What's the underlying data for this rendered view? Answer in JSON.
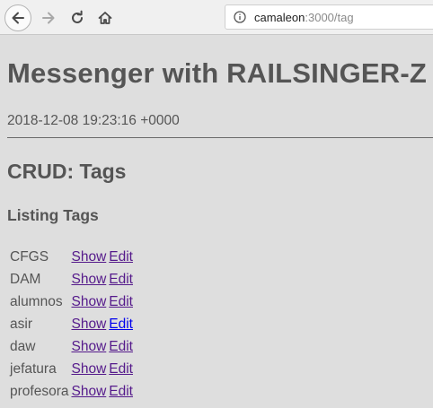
{
  "browser": {
    "url_host": "camaleon",
    "url_rest": ":3000/tag"
  },
  "page": {
    "title": "Messenger with RAILSINGER-Z",
    "timestamp": "2018-12-08 19:23:16 +0000",
    "section_title": "CRUD: Tags",
    "listing_title": "Listing Tags",
    "show_label": "Show",
    "edit_label": "Edit"
  },
  "tags": [
    "CFGS",
    "DAM",
    "alumnos",
    "asir",
    "daw",
    "jefatura",
    "profesora"
  ],
  "colors": {
    "visited_link": "#551a8b",
    "unvisited_link": "#0000ee",
    "text": "#555555",
    "page_background": "#dedede"
  }
}
